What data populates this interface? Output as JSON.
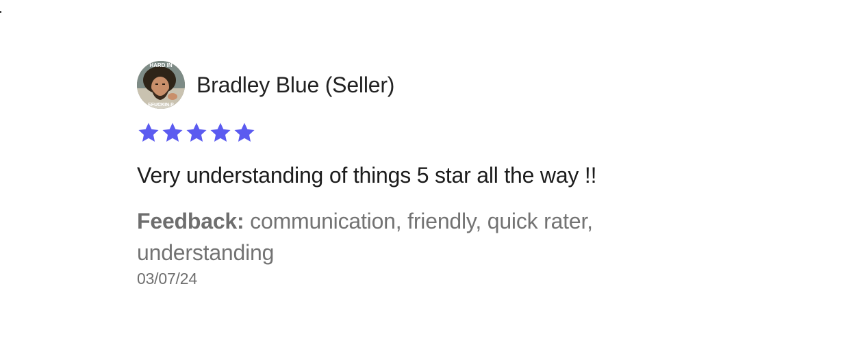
{
  "review": {
    "reviewer_name": "Bradley Blue (Seller)",
    "avatar_caption_top": "HARD IN",
    "avatar_caption_bottom": "EFUCKIN P",
    "rating": 5,
    "rating_max": 5,
    "comment": "Very understanding of things 5 star all the way !!",
    "feedback_label": "Feedback:",
    "feedback_text": " communication, friendly, quick rater, understanding",
    "date": "03/07/24"
  },
  "colors": {
    "star": "#5b5bf0",
    "text_primary": "#1c1c1c",
    "text_secondary": "#737373"
  },
  "icons": {
    "star": "star-icon",
    "avatar": "avatar-image"
  }
}
